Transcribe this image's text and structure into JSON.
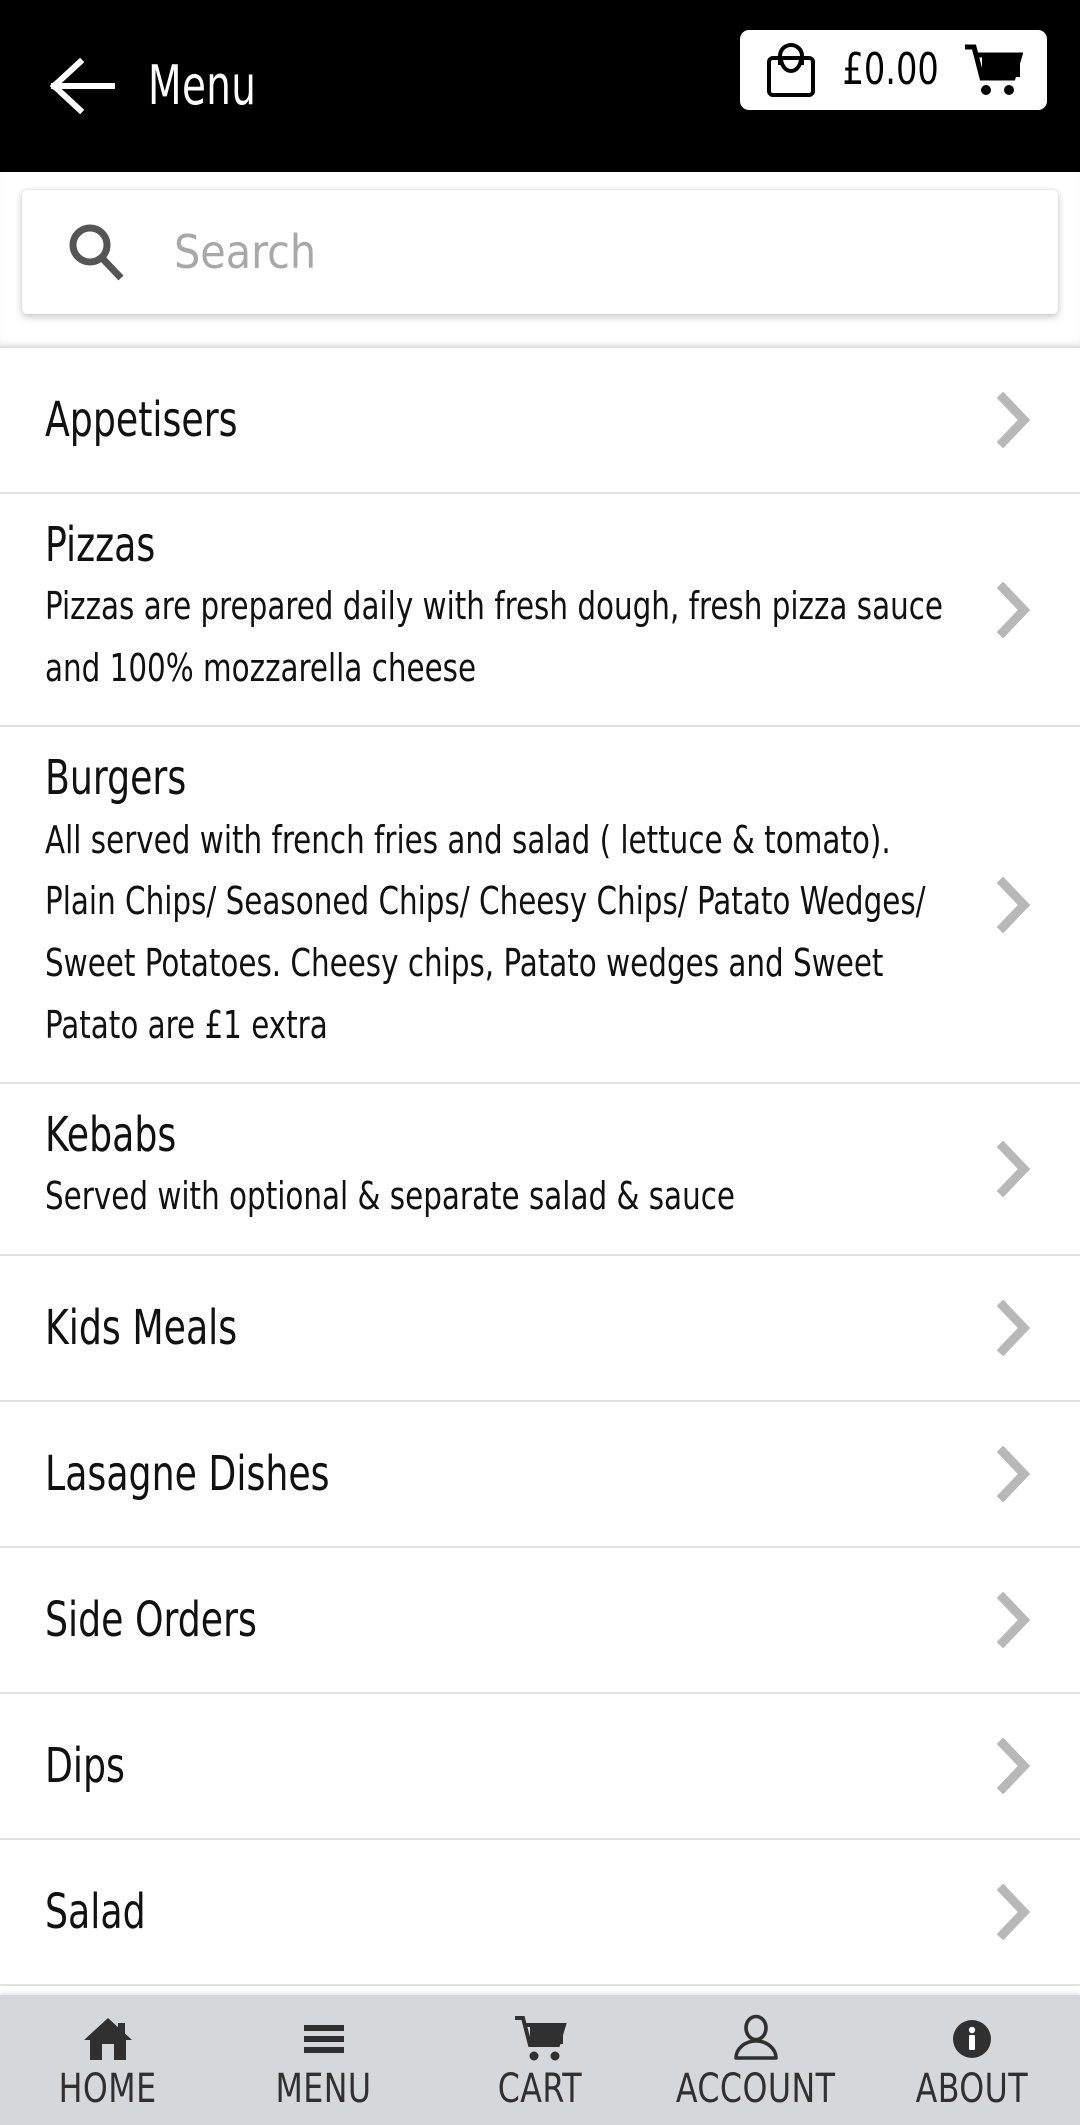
{
  "header": {
    "title": "Menu",
    "back_icon": "arrow-left-icon",
    "cart": {
      "bag_icon": "shopping-bag-icon",
      "amount": "£0.00",
      "cart_icon": "shopping-cart-icon"
    }
  },
  "search": {
    "icon": "search-icon",
    "placeholder": "Search",
    "value": ""
  },
  "colors": {
    "header_bg": "#000000",
    "page_bg": "#ffffff",
    "divider": "#e2e2e2",
    "chevron": "#b8b8b8",
    "nav_bg": "#d5d8da",
    "nav_text": "#303030",
    "placeholder": "#a8a8a8"
  },
  "menu": {
    "chevron_icon": "chevron-right-icon",
    "categories": [
      {
        "title": "Appetisers",
        "description": ""
      },
      {
        "title": "Pizzas",
        "description": "Pizzas are prepared daily with fresh dough, fresh pizza sauce and 100% mozzarella cheese"
      },
      {
        "title": "Burgers",
        "description": "All served with french fries and salad ( lettuce & tomato). Plain Chips/ Seasoned Chips/ Cheesy Chips/ Patato Wedges/ Sweet Potatoes. Cheesy chips, Patato wedges and Sweet Patato are £1 extra"
      },
      {
        "title": "Kebabs",
        "description": "Served with optional & separate salad & sauce"
      },
      {
        "title": "Kids Meals",
        "description": ""
      },
      {
        "title": "Lasagne Dishes",
        "description": ""
      },
      {
        "title": "Side Orders",
        "description": ""
      },
      {
        "title": "Dips",
        "description": ""
      },
      {
        "title": "Salad",
        "description": ""
      }
    ]
  },
  "bottom_nav": {
    "items": [
      {
        "label": "HOME",
        "icon": "home-icon"
      },
      {
        "label": "MENU",
        "icon": "hamburger-menu-icon"
      },
      {
        "label": "CART",
        "icon": "shopping-cart-icon"
      },
      {
        "label": "ACCOUNT",
        "icon": "user-person-icon"
      },
      {
        "label": "ABOUT",
        "icon": "info-circle-icon"
      }
    ]
  }
}
